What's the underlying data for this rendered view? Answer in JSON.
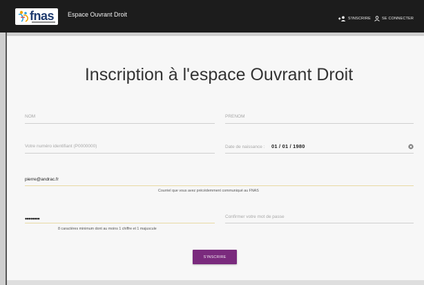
{
  "header": {
    "logo_text": "fnas",
    "app_title": "Espace Ouvrant Droit",
    "signup_label": "S'INSCRIRE",
    "login_label": "SE CONNECTER"
  },
  "page": {
    "title": "Inscription à l'espace Ouvrant Droit"
  },
  "form": {
    "nom_placeholder": "NOM",
    "prenom_placeholder": "PRENOM",
    "identifiant_placeholder": "Votre numéro identifiant (P0000000)",
    "birthdate_label": "Date de naissance :",
    "birthdate_value": "01 / 01 / 1980",
    "email_value": "pierre@andrac.fr",
    "email_hint": "Courriel que vous avez précédemment communiqué au FNAS",
    "password_value": "••••••••",
    "password_hint": "8 caractères minimum dont au moins 1 chiffre et 1 majuscule",
    "confirm_placeholder": "Confirmer votre mot de passe",
    "submit_label": "S'INSCRIRE"
  },
  "colors": {
    "navbar": "#1c1c1c",
    "logo_blue": "#1f3b6e",
    "button_purple": "#7a2a7d",
    "active_underline": "#e8d9a3"
  }
}
